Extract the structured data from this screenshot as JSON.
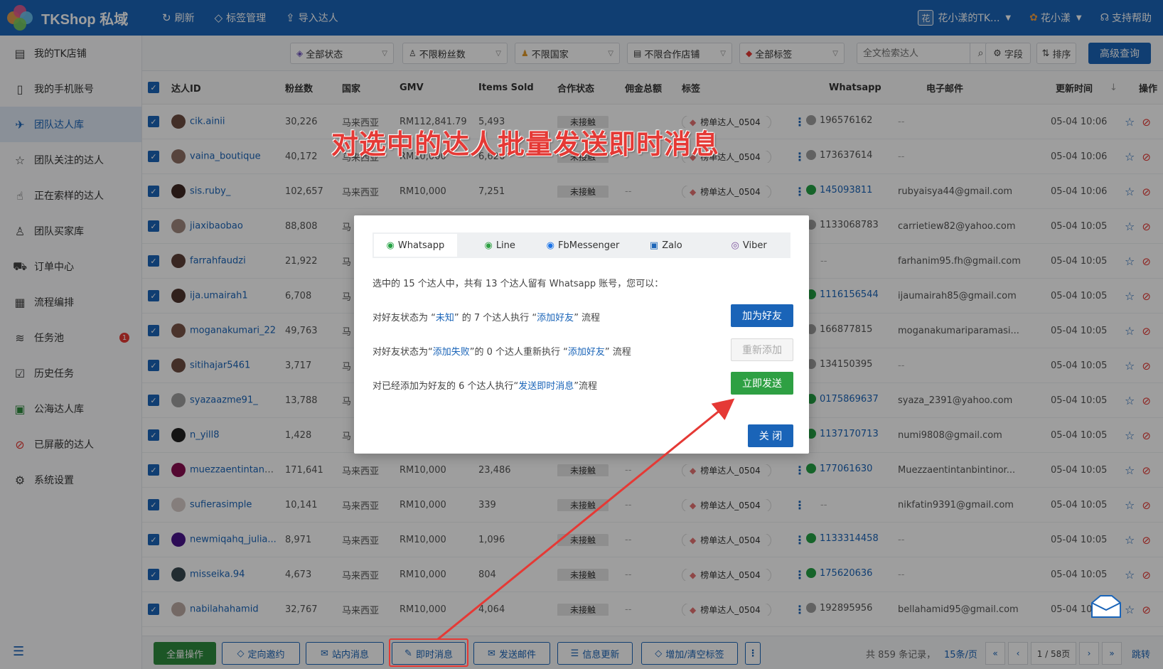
{
  "app": {
    "title": "TKShop 私域",
    "colors": {
      "primary": "#1a64b8",
      "green": "#2ea043",
      "red": "#e53935"
    }
  },
  "topnav": {
    "refresh": "刷新",
    "tags": "标签管理",
    "import": "导入达人",
    "shop_badge": "花",
    "shop": "花小漾的TK...",
    "user": "花小漾",
    "help": "支持帮助"
  },
  "sidebar": {
    "items": [
      {
        "label": "我的TK店铺",
        "icon": "store-icon"
      },
      {
        "label": "我的手机账号",
        "icon": "phone-icon"
      },
      {
        "label": "团队达人库",
        "icon": "team-icon"
      },
      {
        "label": "团队关注的达人",
        "icon": "star-icon"
      },
      {
        "label": "正在索样的达人",
        "icon": "hand-icon"
      },
      {
        "label": "团队买家库",
        "icon": "user-icon"
      },
      {
        "label": "订单中心",
        "icon": "truck-icon"
      },
      {
        "label": "流程编排",
        "icon": "calendar-icon"
      },
      {
        "label": "任务池",
        "icon": "layers-icon"
      },
      {
        "label": "历史任务",
        "icon": "clipboard-icon"
      },
      {
        "label": "公海达人库",
        "icon": "image-icon"
      },
      {
        "label": "已屏蔽的达人",
        "icon": "block-icon"
      },
      {
        "label": "系统设置",
        "icon": "gear-icon"
      }
    ],
    "task_badge": "1"
  },
  "filters": {
    "status": "全部状态",
    "fans": "不限粉丝数",
    "country": "不限国家",
    "shop": "不限合作店铺",
    "tags": "全部标签",
    "search_placeholder": "全文检索达人",
    "fields": "字段",
    "sort": "排序",
    "advanced": "高级查询"
  },
  "table": {
    "headers": {
      "id": "达人ID",
      "fans": "粉丝数",
      "country": "国家",
      "gmv": "GMV",
      "items": "Items Sold",
      "coop": "合作状态",
      "commission": "佣金总额",
      "tag": "标签",
      "whatsapp": "Whatsapp",
      "email": "电子邮件",
      "updated": "更新时间",
      "ops": "操作"
    },
    "rows": [
      {
        "id": "cik.ainii",
        "fans": "30,226",
        "country": "马来西亚",
        "gmv": "RM112,841.79",
        "items": "5,493",
        "coop": "未接触",
        "commission": "",
        "tag": "榜单达人_0504",
        "wa": "196576162",
        "wa_on": false,
        "email": "--",
        "updated": "05-04 10:06"
      },
      {
        "id": "vaina_boutique",
        "fans": "40,172",
        "country": "马来西亚",
        "gmv": "RM10,000",
        "items": "6,626",
        "coop": "未接触",
        "commission": "",
        "tag": "榜单达人_0504",
        "wa": "173637614",
        "wa_on": false,
        "email": "--",
        "updated": "05-04 10:06"
      },
      {
        "id": "sis.ruby_",
        "fans": "102,657",
        "country": "马来西亚",
        "gmv": "RM10,000",
        "items": "7,251",
        "coop": "未接触",
        "commission": "--",
        "tag": "榜单达人_0504",
        "wa": "145093811",
        "wa_on": true,
        "email": "rubyaisya44@gmail.com",
        "updated": "05-04 10:06"
      },
      {
        "id": "jiaxibaobao",
        "fans": "88,808",
        "country": "马",
        "gmv": "",
        "items": "",
        "coop": "",
        "commission": "",
        "tag": "",
        "wa": "1133068783",
        "wa_on": false,
        "email": "carrietiew82@yahoo.com",
        "updated": "05-04 10:05"
      },
      {
        "id": "farrahfaudzi",
        "fans": "21,922",
        "country": "马",
        "gmv": "",
        "items": "",
        "coop": "",
        "commission": "",
        "tag": "",
        "wa": "--",
        "wa_on": null,
        "email": "farhanim95.fh@gmail.com",
        "updated": "05-04 10:05"
      },
      {
        "id": "ija.umairah1",
        "fans": "6,708",
        "country": "马",
        "gmv": "",
        "items": "",
        "coop": "",
        "commission": "",
        "tag": "",
        "wa": "1116156544",
        "wa_on": true,
        "email": "ijaumairah85@gmail.com",
        "updated": "05-04 10:05"
      },
      {
        "id": "moganakumari_22",
        "fans": "49,763",
        "country": "马",
        "gmv": "",
        "items": "",
        "coop": "",
        "commission": "",
        "tag": "",
        "wa": "166877815",
        "wa_on": false,
        "email": "moganakumariparamasi...",
        "updated": "05-04 10:05"
      },
      {
        "id": "sitihajar5461",
        "fans": "3,717",
        "country": "马",
        "gmv": "",
        "items": "",
        "coop": "",
        "commission": "",
        "tag": "",
        "wa": "134150395",
        "wa_on": false,
        "email": "--",
        "updated": "05-04 10:05"
      },
      {
        "id": "syazaazme91_",
        "fans": "13,788",
        "country": "马",
        "gmv": "",
        "items": "",
        "coop": "",
        "commission": "",
        "tag": "",
        "wa": "0175869637",
        "wa_on": true,
        "email": "syaza_2391@yahoo.com",
        "updated": "05-04 10:05"
      },
      {
        "id": "n_yill8",
        "fans": "1,428",
        "country": "马",
        "gmv": "",
        "items": "",
        "coop": "",
        "commission": "",
        "tag": "",
        "wa": "1137170713",
        "wa_on": true,
        "email": "numi9808@gmail.com",
        "updated": "05-04 10:05"
      },
      {
        "id": "muezzaentintanbin",
        "fans": "171,641",
        "country": "马来西亚",
        "gmv": "RM10,000",
        "items": "23,486",
        "coop": "未接触",
        "commission": "--",
        "tag": "榜单达人_0504",
        "wa": "177061630",
        "wa_on": true,
        "email": "Muezzaentintanbintinor...",
        "updated": "05-04 10:05"
      },
      {
        "id": "sufierasimple",
        "fans": "10,141",
        "country": "马来西亚",
        "gmv": "RM10,000",
        "items": "339",
        "coop": "未接触",
        "commission": "--",
        "tag": "榜单达人_0504",
        "wa": "--",
        "wa_on": null,
        "email": "nikfatin9391@gmail.com",
        "updated": "05-04 10:05"
      },
      {
        "id": "newmiqahq_julia...",
        "fans": "8,971",
        "country": "马来西亚",
        "gmv": "RM10,000",
        "items": "1,096",
        "coop": "未接触",
        "commission": "--",
        "tag": "榜单达人_0504",
        "wa": "1133314458",
        "wa_on": true,
        "email": "--",
        "updated": "05-04 10:05"
      },
      {
        "id": "misseika.94",
        "fans": "4,673",
        "country": "马来西亚",
        "gmv": "RM10,000",
        "items": "804",
        "coop": "未接触",
        "commission": "--",
        "tag": "榜单达人_0504",
        "wa": "175620636",
        "wa_on": true,
        "email": "--",
        "updated": "05-04 10:05"
      },
      {
        "id": "nabilahahamid",
        "fans": "32,767",
        "country": "马来西亚",
        "gmv": "RM10,000",
        "items": "4,064",
        "coop": "未接触",
        "commission": "--",
        "tag": "榜单达人_0504",
        "wa": "192895956",
        "wa_on": false,
        "email": "bellahamid95@gmail.com",
        "updated": "05-04 10"
      }
    ]
  },
  "bottom": {
    "all_ops": "全量操作",
    "invite": "定向邀约",
    "site_msg": "站内消息",
    "instant_msg": "即时消息",
    "send_email": "发送邮件",
    "info_update": "信息更新",
    "tags": "增加/清空标签",
    "total": "共 859 条记录，",
    "page_size": "15条/页",
    "page": "1 / 58页",
    "jump": "跳转"
  },
  "modal": {
    "tabs": [
      "Whatsapp",
      "Line",
      "FbMessenger",
      "Zalo",
      "Viber"
    ],
    "summary": "选中的 15 个达人中，共有 13 个达人留有 Whatsapp 账号，您可以：",
    "line1": {
      "a": "对好友状态为 “",
      "hl1": "未知",
      "b": "” 的 7 个达人执行 “",
      "hl2": "添加好友",
      "c": "” 流程",
      "btn": "加为好友"
    },
    "line2": {
      "a": "对好友状态为“",
      "hl1": "添加失败",
      "b": "”的 0 个达人重新执行 “",
      "hl2": "添加好友",
      "c": "” 流程",
      "btn": "重新添加"
    },
    "line3": {
      "a": "对已经添加为好友的 6 个达人执行“",
      "hl1": "发送即时消息",
      "b": "”流程",
      "btn": "立即发送"
    },
    "close": "关 闭"
  },
  "annotation": "对选中的达人批量发送即时消息"
}
